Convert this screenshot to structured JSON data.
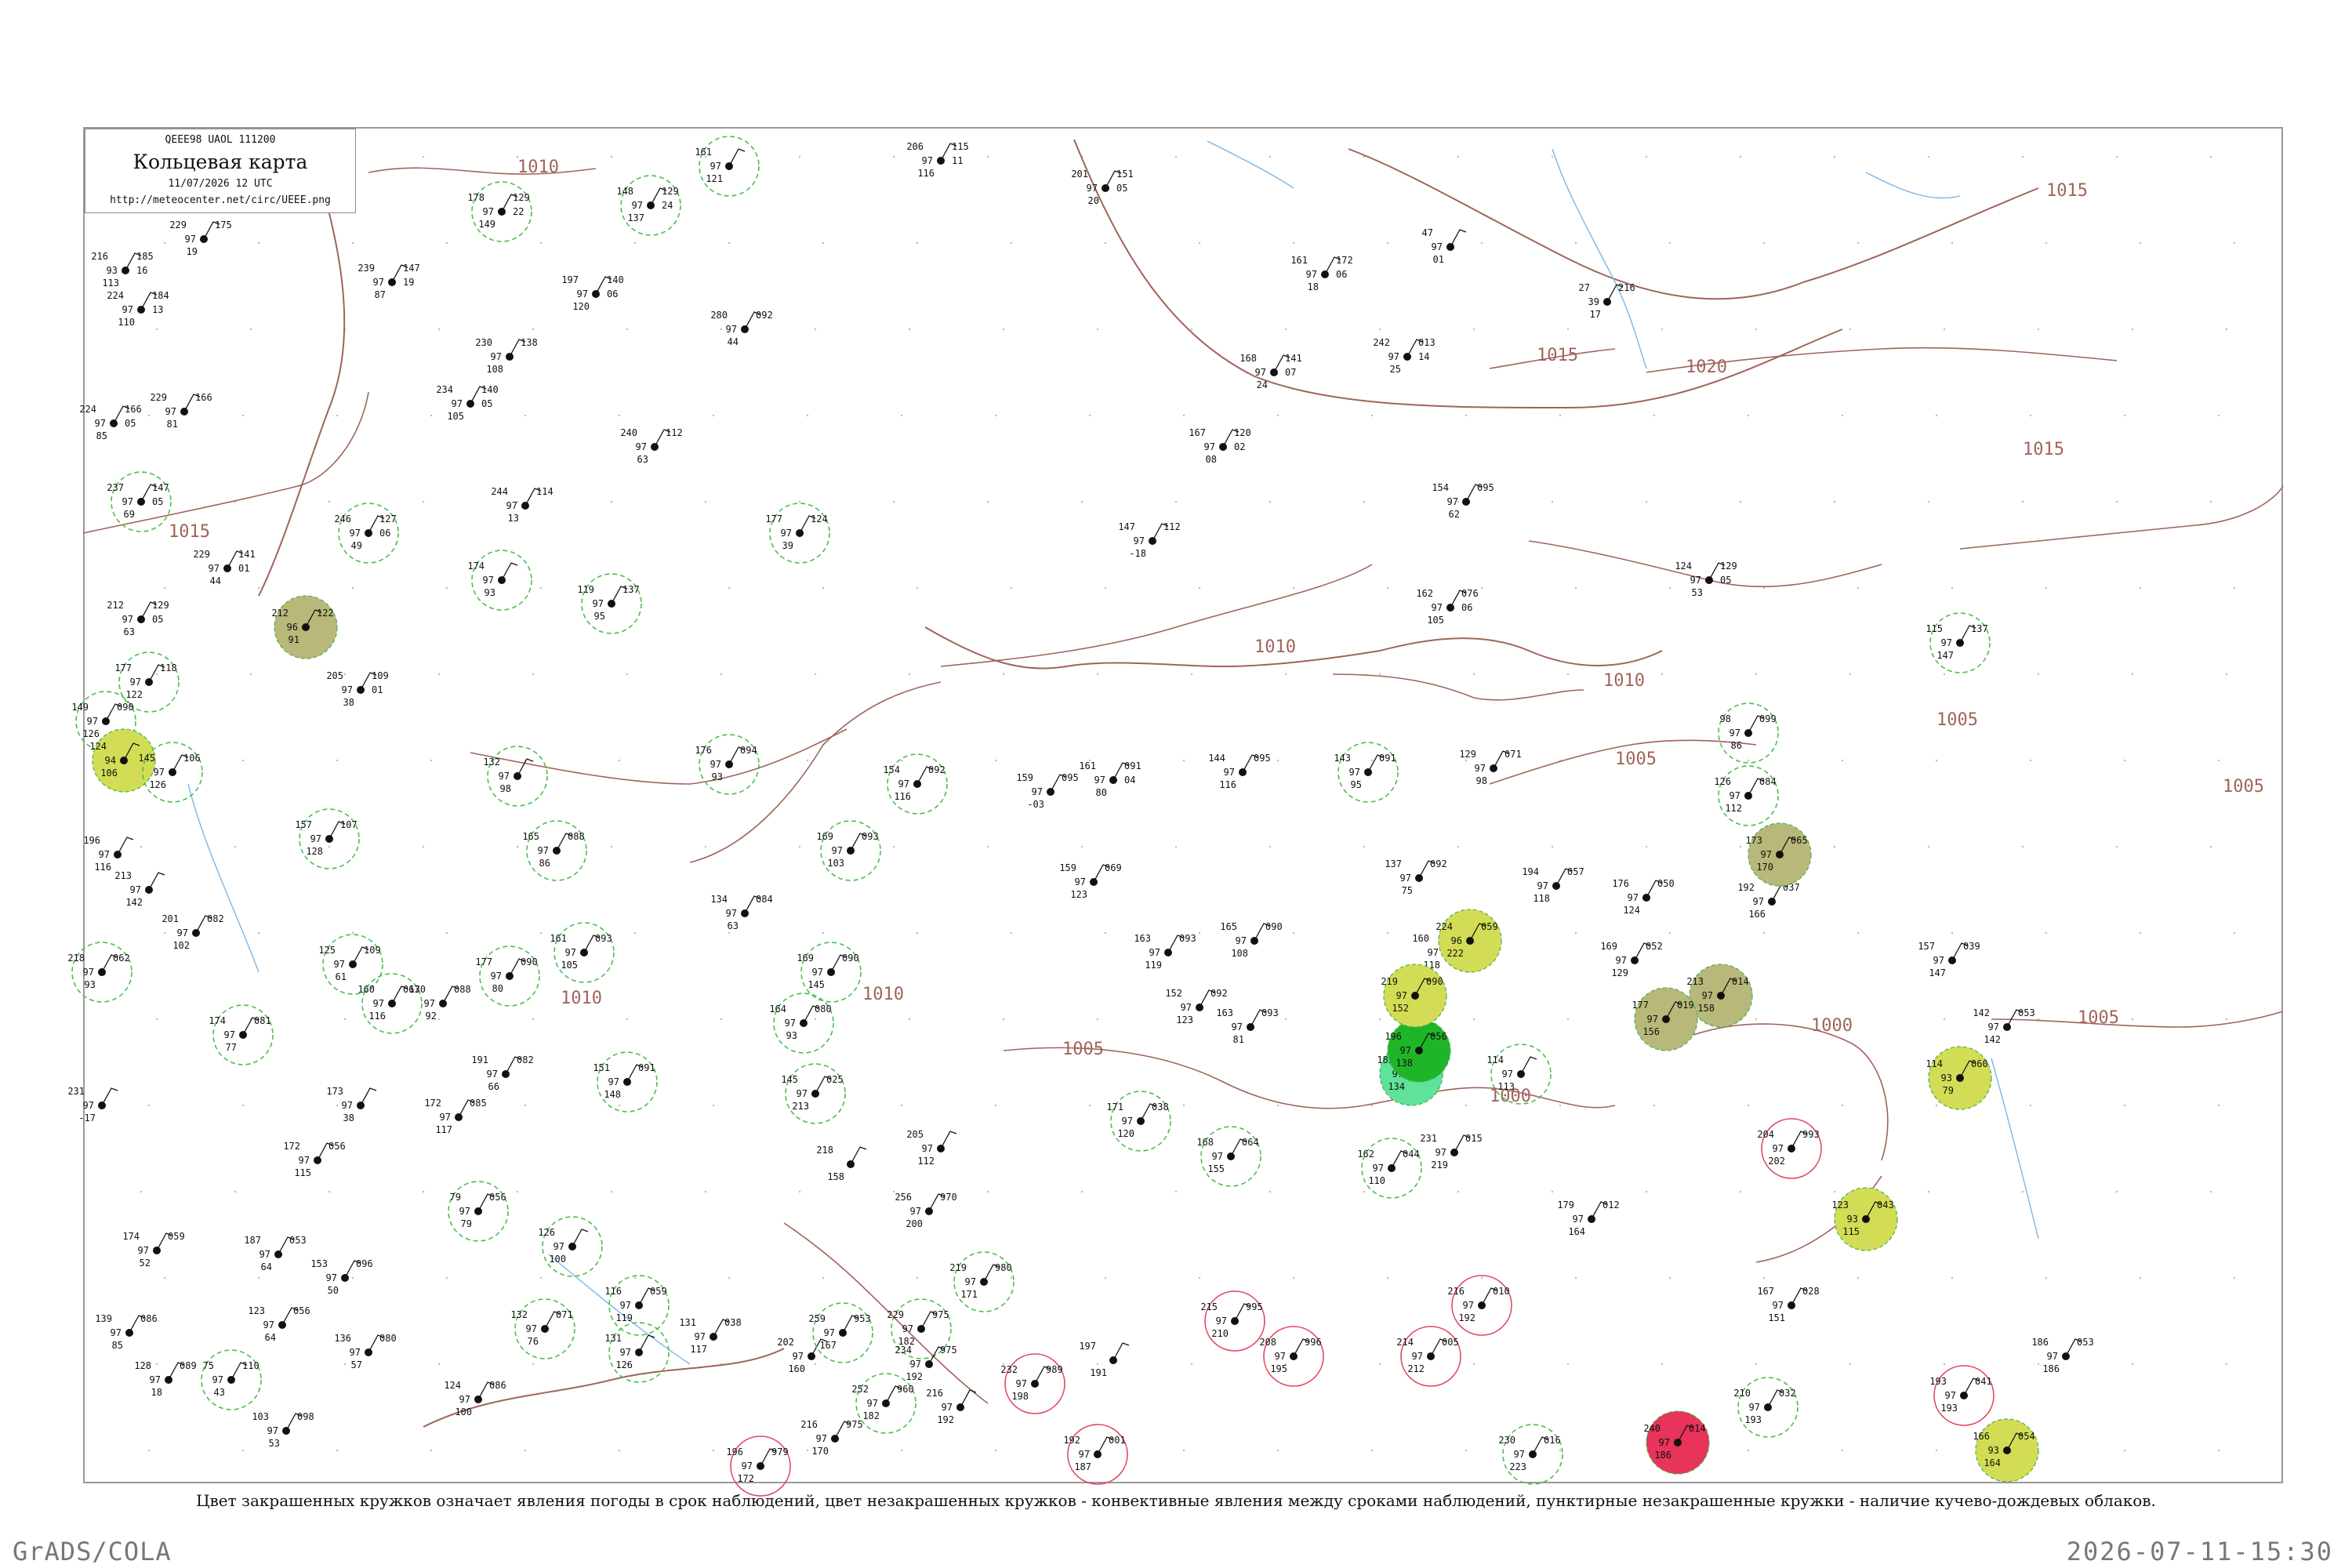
{
  "header": {
    "codes": "QEEE98  UAOL  111200",
    "title": "Кольцевая карта",
    "datetime": "11/07/2026 12 UTC",
    "url": "http://meteocenter.net/circ/UEEE.png"
  },
  "legend_text": "Цвет закрашенных кружков означает явления погоды в срок наблюдений, цвет незакрашенных кружков - конвективные явления между сроками наблюдений, пунктирные незакрашенные кружки - наличие кучево-дождевых облаков.",
  "footer": {
    "left": "GrADS/COLA",
    "right": "2026-07-11-15:30"
  },
  "colors": {
    "isobar": "#a0645a",
    "river": "#79b6e6",
    "frame": "#9a9a9a",
    "rain_fill": "#1fb528",
    "rain_ring": "#4cbf4c",
    "thunder_fill": "#e8335a",
    "thunder_ring": "#e0485e",
    "fog_fill": "#d2dd55",
    "haze_fill": "#b8b87a",
    "mist_fill": "#5fe29a",
    "amber_fill": "#f5b046"
  },
  "isobars": [
    {
      "label": "1010"
    },
    {
      "label": "1015"
    },
    {
      "label": "1010"
    },
    {
      "label": "1010"
    },
    {
      "label": "1010"
    },
    {
      "label": "1015"
    },
    {
      "label": "1020"
    },
    {
      "label": "1015"
    },
    {
      "label": "1015"
    },
    {
      "label": "1010"
    },
    {
      "label": "1005"
    },
    {
      "label": "1005"
    },
    {
      "label": "1005"
    },
    {
      "label": "1000"
    },
    {
      "label": "1005"
    },
    {
      "label": "1005"
    },
    {
      "label": "1000"
    }
  ],
  "stations": [
    {
      "top": "206",
      "right": "115",
      "left2": "97",
      "right2": "11",
      "bottom": "116"
    },
    {
      "top": "161",
      "right": "",
      "left2": "97",
      "right2": "",
      "bottom": "121"
    },
    {
      "top": "201",
      "right": "151",
      "left2": "97",
      "right2": "05",
      "bottom": "20"
    },
    {
      "top": "178",
      "right": "129",
      "left2": "97",
      "right2": "22",
      "bottom": "149"
    },
    {
      "top": "148",
      "right": "129",
      "left2": "97",
      "right2": "24",
      "bottom": "137"
    },
    {
      "top": "229",
      "right": "175",
      "left2": "97",
      "right2": "",
      "bottom": "19"
    },
    {
      "top": "216",
      "right": "185",
      "left2": "93",
      "right2": "16",
      "bottom": "113"
    },
    {
      "top": "224",
      "right": "184",
      "left2": "97",
      "right2": "13",
      "bottom": "110"
    },
    {
      "top": "239",
      "right": "147",
      "left2": "97",
      "right2": "19",
      "bottom": "87"
    },
    {
      "top": "161",
      "right": "172",
      "left2": "97",
      "right2": "06",
      "bottom": "18"
    },
    {
      "top": "47",
      "right": "",
      "left2": "97",
      "right2": "",
      "bottom": "01"
    },
    {
      "top": "197",
      "right": "140",
      "left2": "97",
      "right2": "06",
      "bottom": "120"
    },
    {
      "top": "230",
      "right": "138",
      "left2": "97",
      "right2": "",
      "bottom": "108"
    },
    {
      "top": "280",
      "right": "092",
      "left2": "97",
      "right2": "",
      "bottom": "44"
    },
    {
      "top": "242",
      "right": "013",
      "left2": "97",
      "right2": "14",
      "bottom": "25"
    },
    {
      "top": "168",
      "right": "141",
      "left2": "97",
      "right2": "07",
      "bottom": "24"
    },
    {
      "top": "27",
      "right": "216",
      "left2": "39",
      "right2": "",
      "bottom": "17"
    },
    {
      "top": "224",
      "right": "166",
      "left2": "97",
      "right2": "05",
      "bottom": "85"
    },
    {
      "top": "229",
      "right": "166",
      "left2": "97",
      "right2": "",
      "bottom": "81"
    },
    {
      "top": "234",
      "right": "140",
      "left2": "97",
      "right2": "05",
      "bottom": "105"
    },
    {
      "top": "240",
      "right": "112",
      "left2": "97",
      "right2": "",
      "bottom": "63"
    },
    {
      "top": "167",
      "right": "120",
      "left2": "97",
      "right2": "02",
      "bottom": "08"
    },
    {
      "top": "237",
      "right": "147",
      "left2": "97",
      "right2": "05",
      "bottom": "69"
    },
    {
      "top": "154",
      "right": "095",
      "left2": "97",
      "right2": "",
      "bottom": "62"
    },
    {
      "top": "244",
      "right": "114",
      "left2": "97",
      "right2": "",
      "bottom": "13"
    },
    {
      "top": "246",
      "right": "127",
      "left2": "97",
      "right2": "06",
      "bottom": "49"
    },
    {
      "top": "147",
      "right": "112",
      "left2": "97",
      "right2": "",
      "bottom": "-18"
    },
    {
      "top": "124",
      "right": "129",
      "left2": "97",
      "right2": "05",
      "bottom": "53"
    },
    {
      "top": "229",
      "right": "141",
      "left2": "97",
      "right2": "01",
      "bottom": "44"
    },
    {
      "top": "177",
      "right": "124",
      "left2": "97",
      "right2": "",
      "bottom": "39"
    },
    {
      "top": "174",
      "right": "",
      "left2": "97",
      "right2": "",
      "bottom": "93"
    },
    {
      "top": "212",
      "right": "129",
      "left2": "97",
      "right2": "05",
      "bottom": "63"
    },
    {
      "top": "212",
      "right": "122",
      "left2": "96",
      "right2": "",
      "bottom": "91"
    },
    {
      "top": "119",
      "right": "137",
      "left2": "97",
      "right2": "",
      "bottom": "95"
    },
    {
      "top": "162",
      "right": "076",
      "left2": "97",
      "right2": "06",
      "bottom": "105"
    },
    {
      "top": "115",
      "right": "137",
      "left2": "97",
      "right2": "",
      "bottom": "147"
    },
    {
      "top": "177",
      "right": "118",
      "left2": "97",
      "right2": "",
      "bottom": "122"
    },
    {
      "top": "205",
      "right": "109",
      "left2": "97",
      "right2": "01",
      "bottom": "38"
    },
    {
      "top": "149",
      "right": "090",
      "left2": "97",
      "right2": "",
      "bottom": "126"
    },
    {
      "top": "124",
      "right": "",
      "left2": "94",
      "right2": "",
      "bottom": "106"
    },
    {
      "top": "145",
      "right": "106",
      "left2": "97",
      "right2": "",
      "bottom": "126"
    },
    {
      "top": "176",
      "right": "094",
      "left2": "97",
      "right2": "",
      "bottom": "93"
    },
    {
      "top": "132",
      "right": "",
      "left2": "97",
      "right2": "",
      "bottom": "98"
    },
    {
      "top": "143",
      "right": "091",
      "left2": "97",
      "right2": "",
      "bottom": "95"
    },
    {
      "top": "129",
      "right": "071",
      "left2": "97",
      "right2": "",
      "bottom": "98"
    },
    {
      "top": "144",
      "right": "095",
      "left2": "97",
      "right2": "",
      "bottom": "116"
    },
    {
      "top": "161",
      "right": "091",
      "left2": "97",
      "right2": "04",
      "bottom": "80"
    },
    {
      "top": "159",
      "right": "095",
      "left2": "97",
      "right2": "",
      "bottom": "-03"
    },
    {
      "top": "154",
      "right": "092",
      "left2": "97",
      "right2": "",
      "bottom": "116"
    },
    {
      "top": "98",
      "right": "099",
      "left2": "97",
      "right2": "",
      "bottom": "86"
    },
    {
      "top": "126",
      "right": "084",
      "left2": "97",
      "right2": "",
      "bottom": "112"
    },
    {
      "top": "157",
      "right": "107",
      "left2": "97",
      "right2": "",
      "bottom": "128"
    },
    {
      "top": "165",
      "right": "088",
      "left2": "97",
      "right2": "",
      "bottom": "86"
    },
    {
      "top": "169",
      "right": "093",
      "left2": "97",
      "right2": "",
      "bottom": "103"
    },
    {
      "top": "159",
      "right": "069",
      "left2": "97",
      "right2": "",
      "bottom": "123"
    },
    {
      "top": "137",
      "right": "092",
      "left2": "97",
      "right2": "",
      "bottom": "75"
    },
    {
      "top": "194",
      "right": "057",
      "left2": "97",
      "right2": "",
      "bottom": "118"
    },
    {
      "top": "176",
      "right": "050",
      "left2": "97",
      "right2": "",
      "bottom": "124"
    },
    {
      "top": "192",
      "right": "037",
      "left2": "97",
      "right2": "",
      "bottom": "166"
    },
    {
      "top": "196",
      "right": "",
      "left2": "97",
      "right2": "",
      "bottom": "116"
    },
    {
      "top": "213",
      "right": "",
      "left2": "97",
      "right2": "",
      "bottom": "142"
    },
    {
      "top": "201",
      "right": "082",
      "left2": "97",
      "right2": "",
      "bottom": "102"
    },
    {
      "top": "134",
      "right": "084",
      "left2": "97",
      "right2": "",
      "bottom": "63"
    },
    {
      "top": "218",
      "right": "062",
      "left2": "97",
      "right2": "",
      "bottom": "93"
    },
    {
      "top": "125",
      "right": "109",
      "left2": "97",
      "right2": "",
      "bottom": "61"
    },
    {
      "top": "160",
      "right": "063",
      "left2": "97",
      "right2": "",
      "bottom": "116"
    },
    {
      "top": "177",
      "right": "090",
      "left2": "97",
      "right2": "",
      "bottom": "80"
    },
    {
      "top": "161",
      "right": "093",
      "left2": "97",
      "right2": "",
      "bottom": "105"
    },
    {
      "top": "169",
      "right": "090",
      "left2": "97",
      "right2": "",
      "bottom": "145"
    },
    {
      "top": "163",
      "right": "093",
      "left2": "97",
      "right2": "",
      "bottom": "119"
    },
    {
      "top": "165",
      "right": "090",
      "left2": "97",
      "right2": "",
      "bottom": "108"
    },
    {
      "top": "160",
      "right": "078",
      "left2": "97",
      "right2": "",
      "bottom": "118"
    },
    {
      "top": "224",
      "right": "059",
      "left2": "96",
      "right2": "",
      "bottom": "222"
    },
    {
      "top": "169",
      "right": "052",
      "left2": "97",
      "right2": "",
      "bottom": "129"
    },
    {
      "top": "157",
      "right": "039",
      "left2": "97",
      "right2": "",
      "bottom": "147"
    },
    {
      "top": "142",
      "right": "053",
      "left2": "97",
      "right2": "",
      "bottom": "142"
    },
    {
      "top": "174",
      "right": "081",
      "left2": "97",
      "right2": "",
      "bottom": "77"
    },
    {
      "top": "170",
      "right": "088",
      "left2": "97",
      "right2": "",
      "bottom": "92"
    },
    {
      "top": "152",
      "right": "092",
      "left2": "97",
      "right2": "",
      "bottom": "123"
    },
    {
      "top": "163",
      "right": "093",
      "left2": "97",
      "right2": "",
      "bottom": "81"
    },
    {
      "top": "191",
      "right": "082",
      "left2": "97",
      "right2": "",
      "bottom": "66"
    },
    {
      "top": "172",
      "right": "085",
      "left2": "97",
      "right2": "",
      "bottom": "117"
    },
    {
      "top": "173",
      "right": "",
      "left2": "97",
      "right2": "",
      "bottom": "38"
    },
    {
      "top": "151",
      "right": "091",
      "left2": "97",
      "right2": "",
      "bottom": "148"
    },
    {
      "top": "164",
      "right": "080",
      "left2": "97",
      "right2": "",
      "bottom": "93"
    },
    {
      "top": "145",
      "right": "025",
      "left2": "97",
      "right2": "",
      "bottom": "213"
    },
    {
      "top": "171",
      "right": "038",
      "left2": "97",
      "right2": "",
      "bottom": "120"
    },
    {
      "top": "168",
      "right": "064",
      "left2": "97",
      "right2": "",
      "bottom": "155"
    },
    {
      "top": "162",
      "right": "044",
      "left2": "97",
      "right2": "",
      "bottom": "110"
    },
    {
      "top": "231",
      "right": "015",
      "left2": "97",
      "right2": "",
      "bottom": "219"
    },
    {
      "top": "204",
      "right": "993",
      "left2": "97",
      "right2": "",
      "bottom": "202"
    },
    {
      "top": "114",
      "right": "060",
      "left2": "93",
      "right2": "",
      "bottom": "79"
    },
    {
      "top": "123",
      "right": "043",
      "left2": "93",
      "right2": "",
      "bottom": "115"
    },
    {
      "top": "179",
      "right": "012",
      "left2": "97",
      "right2": "",
      "bottom": "164"
    },
    {
      "top": "205",
      "right": "",
      "left2": "97",
      "right2": "",
      "bottom": "112"
    },
    {
      "top": "218",
      "right": "",
      "left2": "",
      "right2": "",
      "bottom": "158"
    },
    {
      "top": "231",
      "right": "",
      "left2": "97",
      "right2": "",
      "bottom": "-17"
    },
    {
      "top": "172",
      "right": "056",
      "left2": "97",
      "right2": "",
      "bottom": "115"
    },
    {
      "top": "79",
      "right": "056",
      "left2": "97",
      "right2": "",
      "bottom": "79"
    },
    {
      "top": "126",
      "right": "",
      "left2": "97",
      "right2": "",
      "bottom": "100"
    },
    {
      "top": "174",
      "right": "059",
      "left2": "97",
      "right2": "",
      "bottom": "52"
    },
    {
      "top": "187",
      "right": "053",
      "left2": "97",
      "right2": "",
      "bottom": "64"
    },
    {
      "top": "153",
      "right": "096",
      "left2": "97",
      "right2": "",
      "bottom": "50"
    },
    {
      "top": "123",
      "right": "056",
      "left2": "97",
      "right2": "",
      "bottom": "64"
    },
    {
      "top": "136",
      "right": "080",
      "left2": "97",
      "right2": "",
      "bottom": "57"
    },
    {
      "top": "139",
      "right": "086",
      "left2": "97",
      "right2": "",
      "bottom": "85"
    },
    {
      "top": "128",
      "right": "089",
      "left2": "97",
      "right2": "",
      "bottom": "18"
    },
    {
      "top": "75",
      "right": "110",
      "left2": "97",
      "right2": "",
      "bottom": "43"
    },
    {
      "top": "103",
      "right": "098",
      "left2": "97",
      "right2": "",
      "bottom": "53"
    },
    {
      "top": "124",
      "right": "086",
      "left2": "97",
      "right2": "",
      "bottom": "100"
    },
    {
      "top": "132",
      "right": "071",
      "left2": "97",
      "right2": "",
      "bottom": "76"
    },
    {
      "top": "116",
      "right": "059",
      "left2": "97",
      "right2": "",
      "bottom": "119"
    },
    {
      "top": "131",
      "right": "",
      "left2": "97",
      "right2": "",
      "bottom": "126"
    },
    {
      "top": "131",
      "right": "038",
      "left2": "97",
      "right2": "",
      "bottom": "117"
    },
    {
      "top": "202",
      "right": "",
      "left2": "97",
      "right2": "",
      "bottom": "160"
    },
    {
      "top": "259",
      "right": "953",
      "left2": "97",
      "right2": "",
      "bottom": "167"
    },
    {
      "top": "229",
      "right": "975",
      "left2": "97",
      "right2": "",
      "bottom": "182"
    },
    {
      "top": "219",
      "right": "980",
      "left2": "97",
      "right2": "",
      "bottom": "171"
    },
    {
      "top": "256",
      "right": "970",
      "left2": "97",
      "right2": "",
      "bottom": "200"
    },
    {
      "top": "234",
      "right": "975",
      "left2": "97",
      "right2": "",
      "bottom": "192"
    },
    {
      "top": "232",
      "right": "989",
      "left2": "97",
      "right2": "",
      "bottom": "198"
    },
    {
      "top": "197",
      "right": "",
      "left2": "",
      "right2": "",
      "bottom": "191"
    },
    {
      "top": "215",
      "right": "995",
      "left2": "97",
      "right2": "",
      "bottom": "210"
    },
    {
      "top": "208",
      "right": "996",
      "left2": "97",
      "right2": "",
      "bottom": "195"
    },
    {
      "top": "214",
      "right": "005",
      "left2": "97",
      "right2": "",
      "bottom": "212"
    },
    {
      "top": "216",
      "right": "010",
      "left2": "97",
      "right2": "",
      "bottom": "192"
    },
    {
      "top": "230",
      "right": "016",
      "left2": "97",
      "right2": "",
      "bottom": "223"
    },
    {
      "top": "210",
      "right": "032",
      "left2": "97",
      "right2": "",
      "bottom": "193"
    },
    {
      "top": "193",
      "right": "041",
      "left2": "97",
      "right2": "",
      "bottom": "193"
    },
    {
      "top": "186",
      "right": "053",
      "left2": "97",
      "right2": "",
      "bottom": "186"
    },
    {
      "top": "166",
      "right": "054",
      "left2": "93",
      "right2": "",
      "bottom": "164"
    },
    {
      "top": "167",
      "right": "028",
      "left2": "97",
      "right2": "",
      "bottom": "151"
    },
    {
      "top": "192",
      "right": "001",
      "left2": "97",
      "right2": "",
      "bottom": "187"
    },
    {
      "top": "196",
      "right": "979",
      "left2": "97",
      "right2": "",
      "bottom": "172"
    },
    {
      "top": "216",
      "right": "975",
      "left2": "97",
      "right2": "",
      "bottom": "170"
    },
    {
      "top": "252",
      "right": "960",
      "left2": "97",
      "right2": "",
      "bottom": "182"
    },
    {
      "top": "216",
      "right": "",
      "left2": "97",
      "right2": "",
      "bottom": "192"
    },
    {
      "top": "240",
      "right": "014",
      "left2": "97",
      "right2": "",
      "bottom": "186"
    },
    {
      "top": "213",
      "right": "014",
      "left2": "97",
      "right2": "",
      "bottom": "158"
    },
    {
      "top": "177",
      "right": "019",
      "left2": "97",
      "right2": "",
      "bottom": "156"
    },
    {
      "top": "173",
      "right": "065",
      "left2": "97",
      "right2": "",
      "bottom": "170"
    },
    {
      "top": "114",
      "right": "",
      "left2": "97",
      "right2": "",
      "bottom": "113"
    },
    {
      "top": "183",
      "right": "",
      "left2": "97",
      "right2": "",
      "bottom": "134"
    },
    {
      "top": "196",
      "right": "056",
      "left2": "97",
      "right2": "",
      "bottom": "138"
    },
    {
      "top": "219",
      "right": "090",
      "left2": "97",
      "right2": "",
      "bottom": "152"
    }
  ]
}
